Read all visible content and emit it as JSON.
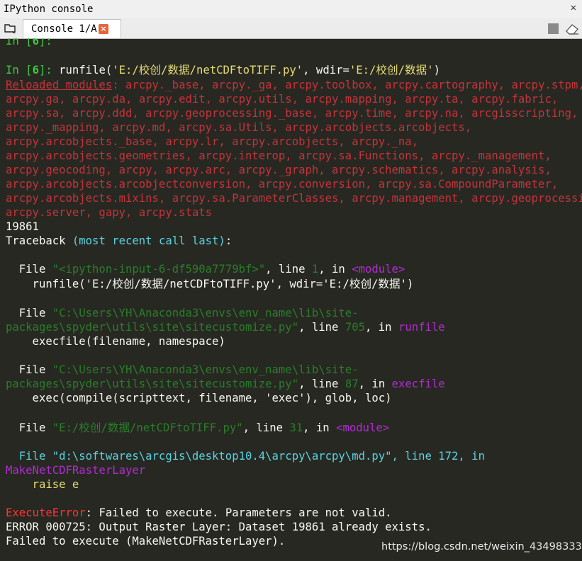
{
  "titlebar": {
    "title": "IPython console"
  },
  "tab": {
    "label": "Console 1/A",
    "close_glyph": "×"
  },
  "icons": {
    "browse": "browse-tabs-icon",
    "stop": "stop-icon",
    "clear": "eraser-icon"
  },
  "colors": {
    "background": "#272822",
    "prompt": "#3ec93e",
    "reloaded": "#c4333a",
    "cyan": "#5ad2e0",
    "path": "#2a7d2a",
    "magenta": "#b22bd2",
    "error": "#ff3333"
  },
  "console": {
    "l0": {
      "a": "In [",
      "b": "6",
      "c": "]:"
    },
    "l1": {
      "a": "In [",
      "b": "6",
      "c": "]: ",
      "d": "runfile(",
      "e": "'E:/校创/数据/netCDFtoTIFF.py'",
      "f": ", wdir=",
      "g": "'E:/校创/数据'",
      "h": ")"
    },
    "l2": {
      "a": "Reloaded modules",
      "b": ": arcpy._base, arcpy._ga, arcpy.toolbox, arcpy.cartography, arcpy.stpm,"
    },
    "l3": "arcpy.ga, arcpy.da, arcpy.edit, arcpy.utils, arcpy.mapping, arcpy.ta, arcpy.fabric,",
    "l4": "arcpy.sa, arcpy.ddd, arcpy.geoprocessing._base, arcpy.time, arcpy.na, arcgisscripting,",
    "l5": "arcpy._mapping, arcpy.md, arcpy.sa.Utils, arcpy.arcobjects.arcobjects,",
    "l6": "arcpy.arcobjects._base, arcpy.lr, arcpy.arcobjects, arcpy._na,",
    "l7": "arcpy.arcobjects.geometries, arcpy.interop, arcpy.sa.Functions, arcpy._management,",
    "l8": "arcpy.geocoding, arcpy, arcpy.arc, arcpy._graph, arcpy.schematics, arcpy.analysis,",
    "l9": "arcpy.arcobjects.arcobjectconversion, arcpy.conversion, arcpy.sa.CompoundParameter,",
    "l10": "arcpy.arcobjects.mixins, arcpy.sa.ParameterClasses, arcpy.management, arcpy.geoprocessing,",
    "l11": "arcpy.server, gapy, arcpy.stats",
    "l12": "19861",
    "l13": {
      "a": "Traceback ",
      "b": "(most recent call last)",
      "c": ":"
    },
    "l14": {
      "a": "  File ",
      "b": "\"<ipython-input-6-df590a7779bf>\"",
      "c": ", line ",
      "d": "1",
      "e": ", in ",
      "f": "<module>"
    },
    "l15": "    runfile('E:/校创/数据/netCDFtoTIFF.py', wdir='E:/校创/数据')",
    "l16": {
      "a": "  File ",
      "b": "\"C:\\Users\\YH\\Anaconda3\\envs\\env_name\\lib\\site-"
    },
    "l17": {
      "a": "packages\\spyder\\utils\\site\\sitecustomize.py\"",
      "b": ", line ",
      "c": "705",
      "d": ", in ",
      "e": "runfile"
    },
    "l18": "    execfile(filename, namespace)",
    "l19": {
      "a": "  File ",
      "b": "\"C:\\Users\\YH\\Anaconda3\\envs\\env_name\\lib\\site-"
    },
    "l20": {
      "a": "packages\\spyder\\utils\\site\\sitecustomize.py\"",
      "b": ", line ",
      "c": "87",
      "d": ", in ",
      "e": "execfile"
    },
    "l21": "    exec(compile(scripttext, filename, 'exec'), glob, loc)",
    "l22": {
      "a": "  File ",
      "b": "\"E:/校创/数据/netCDFtoTIFF.py\"",
      "c": ", line ",
      "d": "31",
      "e": ", in ",
      "f": "<module>"
    },
    "l23": "  File \"d:\\softwares\\arcgis\\desktop10.4\\arcpy\\arcpy\\md.py\", line 172, in",
    "l24": "MakeNetCDFRasterLayer",
    "l25": "    raise e",
    "l26": {
      "a": "ExecuteError",
      "b": ": Failed to execute. Parameters are not valid."
    },
    "l27": "ERROR 000725: Output Raster Layer: Dataset 19861 already exists.",
    "l28": "Failed to execute (MakeNetCDFRasterLayer)."
  },
  "watermark": "https://blog.csdn.net/weixin_43498333"
}
